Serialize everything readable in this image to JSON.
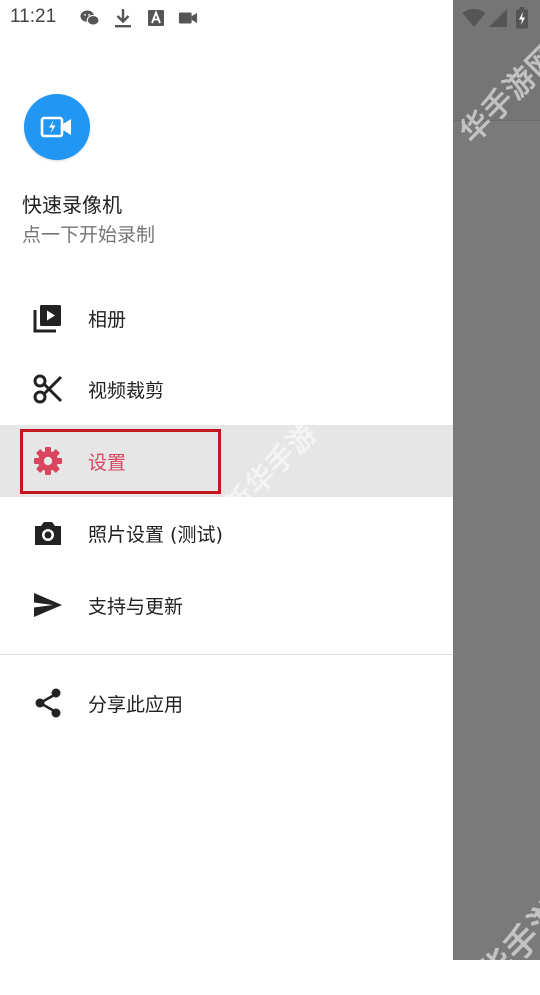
{
  "status_bar": {
    "time": "11:21",
    "icons": [
      "wechat-icon",
      "download-icon",
      "text-box-icon",
      "video-camera-icon",
      "wifi-icon",
      "signal-icon",
      "battery-charging-icon"
    ]
  },
  "watermark": {
    "text": "华手游网",
    "text_middle": "新华手游"
  },
  "drawer": {
    "app_icon": "video-camera-flash-icon",
    "app_title": "快速录像机",
    "app_subtitle": "点一下开始录制",
    "items": [
      {
        "label": "相册",
        "icon": "video-library-icon",
        "active": false
      },
      {
        "label": "视频裁剪",
        "icon": "scissors-icon",
        "active": false
      },
      {
        "label": "设置",
        "icon": "gear-icon",
        "active": true
      },
      {
        "label": "照片设置 (测试)",
        "icon": "camera-icon",
        "active": false
      },
      {
        "label": "支持与更新",
        "icon": "send-icon",
        "active": false
      }
    ],
    "secondary_items": [
      {
        "label": "分享此应用",
        "icon": "share-icon"
      }
    ]
  },
  "colors": {
    "accent": "#d9455f",
    "app_icon_bg": "#2196f3",
    "highlight_border": "#c4161c",
    "scrim": "#7a7a7a"
  }
}
